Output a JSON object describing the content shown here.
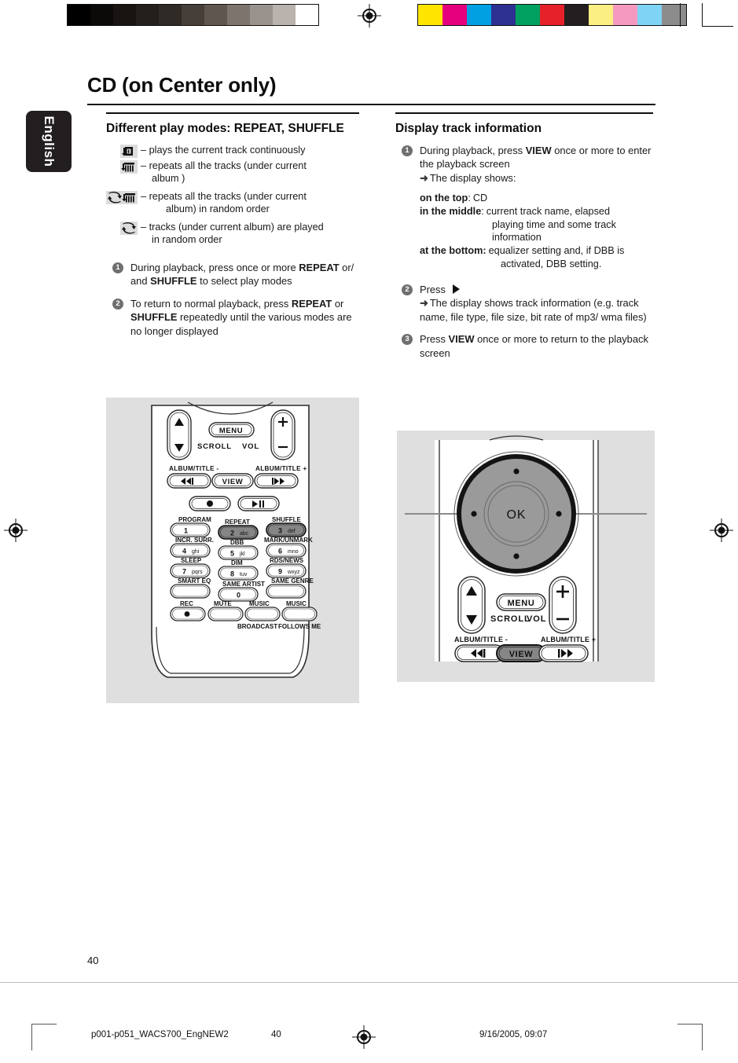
{
  "calibration": {
    "gray_swatches": [
      "#000000",
      "#0b0a09",
      "#171412",
      "#231f1c",
      "#302a26",
      "#463e38",
      "#5f564f",
      "#7d746d",
      "#9a928c",
      "#b9b2ad",
      "#ffffff"
    ],
    "color_swatches": [
      "#ffe500",
      "#e6007e",
      "#00a0e3",
      "#2e3192",
      "#00a160",
      "#e62129",
      "#231f20",
      "#fbee83",
      "#f49ac1",
      "#7fd4f5",
      "#8c8c8c"
    ],
    "reg_mark_name": "registration-target"
  },
  "language_tab": {
    "label": "English"
  },
  "header": {
    "title": "CD (on Center only)"
  },
  "left_column": {
    "section_title": "Different play modes: REPEAT, SHUFFLE",
    "modes": [
      {
        "icon": "repeat-one-icon",
        "desc": "– plays the current track continuously",
        "desc_cont": ""
      },
      {
        "icon": "repeat-all-icon",
        "desc": "– repeats all the tracks (under current",
        "desc_cont": "album )"
      },
      {
        "icon": "shuffle-repeat-all-icon",
        "desc": "– repeats all the tracks (under current",
        "desc_cont": "album) in random order"
      },
      {
        "icon": "shuffle-icon",
        "desc": "– tracks (under current album) are played",
        "desc_cont": "in random order"
      }
    ],
    "steps": [
      {
        "num": "1",
        "part1": "During playback, press once or more ",
        "bold1": "REPEAT",
        "part2": " or/ and ",
        "bold2": "SHUFFLE",
        "part3": " to select play modes"
      },
      {
        "num": "2",
        "part1": "To return to normal playback, press ",
        "bold1": "REPEAT",
        "part2": " or ",
        "bold2": "SHUFFLE",
        "part3": " repeatedly until the various modes are no longer displayed"
      }
    ],
    "figure": {
      "name": "remote-control-full-figure",
      "buttons": {
        "scroll_label": "SCROLL",
        "vol_label": "VOL",
        "menu": "MENU",
        "view": "VIEW",
        "album_title_minus": "ALBUM/TITLE -",
        "album_title_plus": "ALBUM/TITLE +",
        "prev": "144",
        "next": "664",
        "play_pause": "▶II",
        "keypad": [
          {
            "top": "PROGRAM",
            "digit": "1",
            "letters": ""
          },
          {
            "top": "REPEAT",
            "digit": "2",
            "letters": "abc",
            "highlight": true
          },
          {
            "top": "SHUFFLE",
            "digit": "3",
            "letters": "def",
            "highlight": true
          },
          {
            "top": "INCR. SURR.",
            "digit": "4",
            "letters": "ghi"
          },
          {
            "top": "DBB",
            "digit": "5",
            "letters": "jkl"
          },
          {
            "top": "MARK/UNMARK",
            "digit": "6",
            "letters": "mno"
          },
          {
            "top": "SLEEP",
            "digit": "7",
            "letters": "pqrs"
          },
          {
            "top": "DIM",
            "digit": "8",
            "letters": "tuv"
          },
          {
            "top": "RDS/NEWS",
            "digit": "9",
            "letters": "wxyz"
          },
          {
            "top": "SMART EQ",
            "digit": "",
            "letters": ""
          },
          {
            "top": "SAME ARTIST",
            "digit": "0",
            "letters": ""
          },
          {
            "top": "SAME GENRE",
            "digit": "",
            "letters": ""
          }
        ],
        "bottom_row": [
          {
            "top": "REC",
            "bottom": ""
          },
          {
            "top": "MUTE",
            "bottom": ""
          },
          {
            "top": "MUSIC",
            "bottom": "BROADCAST"
          },
          {
            "top": "MUSIC",
            "bottom": "FOLLOWS ME"
          }
        ]
      }
    }
  },
  "right_column": {
    "section_title": "Display track information",
    "step1": {
      "num": "1",
      "part1": "During playback, press ",
      "bold1": "VIEW",
      "part2": " once or more to enter the playback screen",
      "arrow": "➜",
      "arrow_text": "The display shows:"
    },
    "display_spec": [
      {
        "label": "on the top",
        "sep": ":",
        "value": "CD",
        "lines": []
      },
      {
        "label": "in the middle",
        "sep": ":",
        "value": "current track name, elapsed",
        "lines": [
          "playing time and some track",
          "information"
        ]
      },
      {
        "label": "at the bottom:",
        "sep": "",
        "value": "equalizer setting and, if DBB is",
        "lines": [
          "activated, DBB setting."
        ]
      }
    ],
    "step2": {
      "num": "2",
      "part1": "Press ",
      "arrow": "➜",
      "arrow_text": "The display shows track information (e.g. track name, file type, file size, bit rate of mp3/ wma files)"
    },
    "step3": {
      "num": "3",
      "part1": "Press ",
      "bold1": "VIEW",
      "part2": " once or more to return to the playback screen"
    },
    "figure": {
      "name": "remote-navigation-detail-figure",
      "ok_label": "OK",
      "scroll_label": "SCROLL",
      "vol_label": "VOL",
      "menu": "MENU",
      "view": "VIEW",
      "album_title_minus": "ALBUM/TITLE -",
      "album_title_plus": "ALBUM/TITLE +"
    }
  },
  "footer": {
    "page_number": "40",
    "file_name": "p001-p051_WACS700_EngNEW2",
    "sheet_number": "40",
    "timestamp": "9/16/2005, 09:07"
  }
}
